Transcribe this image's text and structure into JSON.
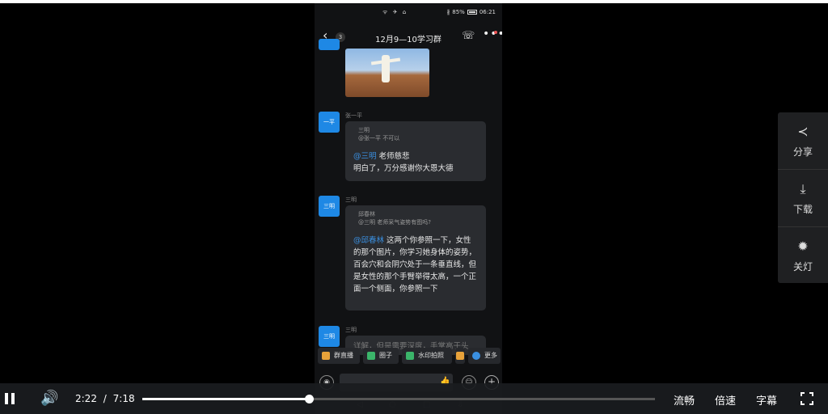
{
  "phone": {
    "status": {
      "network": "ᯤ ✈ ⌂",
      "bluetooth": "∦",
      "battery": "85%",
      "time": "06:21"
    },
    "header": {
      "back_icon": "‹",
      "unread_count": "3",
      "title": "12月9—10学习群",
      "call_icon": "☏",
      "more_icon": "•••"
    },
    "messages": [
      {
        "avatar": "一平",
        "sender": "张一平",
        "quote_name": "三明",
        "quote_text": "@张一平 不可以",
        "mention": "@三明",
        "text_first": " 老师慈悲",
        "text_rest": "明白了，万分感谢你大恩大德"
      },
      {
        "avatar": "三明",
        "sender": "三明",
        "quote_name": "邱春林",
        "quote_text": "@三明 老师采气姿势有图吗?",
        "mention": "@邱春林",
        "text_first": " 这两个你参照一下，女",
        "text_rest": "性的那个图片，你学习她身体的姿势，百会穴和会阴穴处于一条垂直线，但是女性的那个手臂举得太高，一个正面一个侧面，你参照一下"
      },
      {
        "avatar": "三明",
        "sender": "三明",
        "text_first": "详解，但是需要深度，手掌高于头"
      }
    ],
    "toolbar": [
      {
        "label": "群直播",
        "color": "#e8a23a"
      },
      {
        "label": "圈子",
        "color": "#3bb56a"
      },
      {
        "label": "水印拍照",
        "color": "#3bb56a"
      },
      {
        "label": "",
        "color": "#e8a23a"
      },
      {
        "label": "更多",
        "color": "#3a8fe0"
      }
    ],
    "input": {
      "voice_icon": "◉",
      "like_icon": "👍",
      "emoji_icon": "☺",
      "plus_icon": "+"
    },
    "nav": {
      "back": "◁",
      "home": "○",
      "recent": "□",
      "menu": "⇩"
    }
  },
  "side": [
    {
      "icon": "share-icon",
      "glyph": "≺",
      "label": "分享"
    },
    {
      "icon": "download-icon",
      "glyph": "⤓",
      "label": "下载"
    },
    {
      "icon": "light-bulb-icon",
      "glyph": "✹",
      "label": "关灯"
    }
  ],
  "player": {
    "current_time": "2:22",
    "separator": "/",
    "duration": "7:18",
    "progress": 0.325,
    "quality": "流畅",
    "speed": "倍速",
    "subtitle": "字幕",
    "volume_icon": "speaker-icon"
  }
}
